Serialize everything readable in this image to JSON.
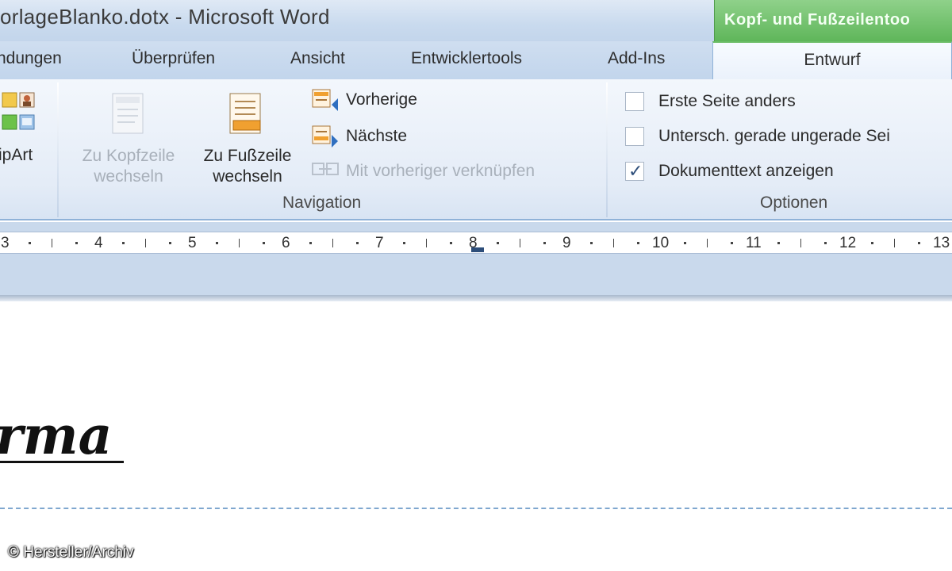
{
  "window": {
    "title": "orlageBlanko.dotx  -  Microsoft Word",
    "context_tab_group": "Kopf- und Fußzeilentoo"
  },
  "tabs": [
    {
      "label": "ndungen"
    },
    {
      "label": "Überprüfen"
    },
    {
      "label": "Ansicht"
    },
    {
      "label": "Entwicklertools"
    },
    {
      "label": "Add-Ins"
    }
  ],
  "active_tab": "Entwurf",
  "ribbon": {
    "insert_group": {
      "clipart_label": "ipArt"
    },
    "navigation": {
      "group_label": "Navigation",
      "to_header": {
        "line1": "Zu Kopfzeile",
        "line2": "wechseln",
        "enabled": false
      },
      "to_footer": {
        "line1": "Zu Fußzeile",
        "line2": "wechseln",
        "enabled": true
      },
      "previous": "Vorherige",
      "next": "Nächste",
      "link_previous": {
        "label": "Mit vorheriger verknüpfen",
        "enabled": false
      }
    },
    "options": {
      "group_label": "Optionen",
      "items": [
        {
          "label": "Erste Seite anders",
          "checked": false
        },
        {
          "label": "Untersch. gerade  ungerade Sei",
          "checked": false
        },
        {
          "label": "Dokumenttext anzeigen",
          "checked": true
        }
      ]
    }
  },
  "ruler": {
    "numbers": [
      "3",
      "4",
      "5",
      "6",
      "7",
      "8",
      "9",
      "10",
      "11",
      "12",
      "13"
    ]
  },
  "document": {
    "heading_text": "rma"
  },
  "credit": "© Hersteller/Archiv",
  "colors": {
    "context_green": "#5fb65a",
    "ribbon_blue": "#c2d5ec",
    "accent_blue": "#2d4e7a"
  }
}
